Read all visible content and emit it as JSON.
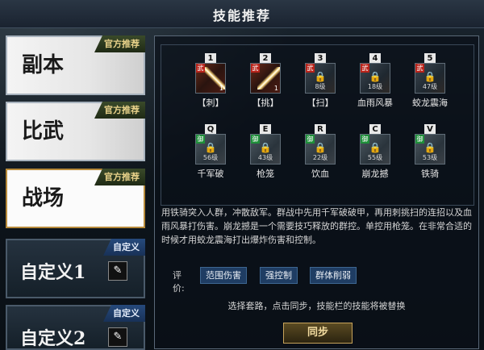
{
  "window": {
    "title": "技能推荐"
  },
  "tabs": [
    {
      "label": "副本",
      "badge": "官方推荐"
    },
    {
      "label": "比武",
      "badge": "官方推荐"
    },
    {
      "label": "战场",
      "badge": "官方推荐"
    },
    {
      "label": "自定义1",
      "badge": "自定义"
    },
    {
      "label": "自定义2",
      "badge": "自定义"
    }
  ],
  "skills_row1": [
    {
      "key": "1",
      "type_tag": "武",
      "level": "",
      "count": "1",
      "name": "【刺】",
      "icon": "spear-thrust-icon",
      "locked": false
    },
    {
      "key": "2",
      "type_tag": "武",
      "level": "",
      "count": "1",
      "name": "【挑】",
      "icon": "spear-lift-icon",
      "locked": false
    },
    {
      "key": "3",
      "type_tag": "武",
      "level": "8级",
      "count": "",
      "name": "【扫】",
      "icon": "lock-icon",
      "locked": true
    },
    {
      "key": "4",
      "type_tag": "武",
      "level": "18级",
      "count": "",
      "name": "血雨风暴",
      "icon": "lock-icon",
      "locked": true
    },
    {
      "key": "5",
      "type_tag": "武",
      "level": "47级",
      "count": "",
      "name": "蛟龙震海",
      "icon": "lock-icon",
      "locked": true
    }
  ],
  "skills_row2": [
    {
      "key": "Q",
      "type_tag": "御",
      "level": "56级",
      "name": "千军破",
      "icon": "lock-icon"
    },
    {
      "key": "E",
      "type_tag": "御",
      "level": "43级",
      "name": "枪笼",
      "icon": "lock-icon"
    },
    {
      "key": "R",
      "type_tag": "御",
      "level": "22级",
      "name": "饮血",
      "icon": "lock-icon"
    },
    {
      "key": "C",
      "type_tag": "御",
      "level": "55级",
      "name": "崩龙撼",
      "icon": "lock-icon"
    },
    {
      "key": "V",
      "type_tag": "御",
      "level": "53级",
      "name": "铁骑",
      "icon": "lock-icon"
    }
  ],
  "description": "用铁骑突入人群，冲散敌军。群战中先用千军破破甲，再用刺挑扫的连招以及血雨风暴打伤害。崩龙撼是一个需要技巧释放的群控。单控用枪笼。在非常合适的时候才用蛟龙震海打出爆炸伤害和控制。",
  "rating": {
    "label": "评价:",
    "tags": [
      "范围伤害",
      "强控制",
      "群体削弱"
    ]
  },
  "hint": "选择套路，点击同步，技能栏的技能将被替换",
  "sync_button": "同步",
  "colors": {
    "badge_official": "#e9d28a",
    "badge_custom": "#183157",
    "tag_bg": "#1f3d63",
    "button_border": "#c6a25a"
  }
}
